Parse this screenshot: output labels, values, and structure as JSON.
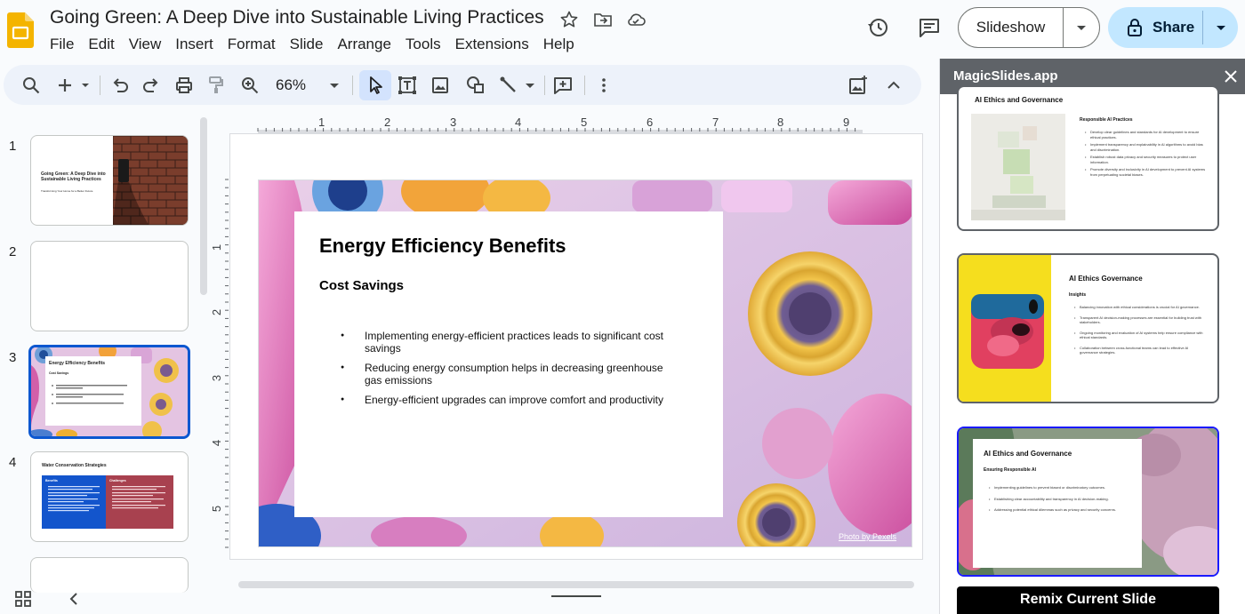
{
  "header": {
    "doc_title": "Going Green: A Deep Dive into Sustainable Living Practices",
    "menu": [
      "File",
      "Edit",
      "View",
      "Insert",
      "Format",
      "Slide",
      "Arrange",
      "Tools",
      "Extensions",
      "Help"
    ],
    "slideshow_label": "Slideshow",
    "share_label": "Share"
  },
  "toolbar": {
    "zoom": "66%"
  },
  "ruler": {
    "top_marks": [
      "1",
      "2",
      "3",
      "4",
      "5",
      "6",
      "7",
      "8",
      "9"
    ],
    "left_marks": [
      "1",
      "2",
      "3",
      "4",
      "5"
    ]
  },
  "filmstrip": {
    "numbers": [
      "1",
      "2",
      "3",
      "4"
    ],
    "thumb1": {
      "title": "Going Green: A Deep Dive into Sustainable Living Practices",
      "subtitle": "Transforming Your Home for a Better Future"
    },
    "thumb3": {
      "title": "Energy Efficiency Benefits",
      "subtitle": "Cost Savings"
    },
    "thumb4": {
      "title": "Water Conservation Strategies",
      "left_head": "Benefits",
      "right_head": "Challenges"
    }
  },
  "slide": {
    "title": "Energy Efficiency Benefits",
    "subtitle": "Cost Savings",
    "bullets": [
      "Implementing energy-efficient practices leads to significant cost savings",
      "Reducing energy consumption helps in decreasing greenhouse gas emissions",
      "Energy-efficient upgrades can improve comfort and productivity"
    ],
    "photo_credit": "Photo by Pexels"
  },
  "panel": {
    "title": "MagicSlides.app",
    "card1": {
      "title": "AI Ethics and Governance",
      "sub": "Responsible AI Practices",
      "bullets": [
        "Develop clear guidelines and standards for AI development to ensure ethical practices.",
        "Implement transparency and explainability in AI algorithms to avoid bias and discrimination.",
        "Establish robust data privacy and security measures to protect user information.",
        "Promote diversity and inclusivity in AI development to prevent AI systems from perpetuating societal biases."
      ]
    },
    "card2": {
      "title": "AI Ethics Governance",
      "sub": "Insights",
      "bullets": [
        "Balancing innovation with ethical considerations is crucial for AI governance.",
        "Transparent AI decision-making processes are essential for building trust with stakeholders.",
        "Ongoing monitoring and evaluation of AI systems help ensure compliance with ethical standards.",
        "Collaboration between cross-functional teams can lead to effective AI governance strategies."
      ]
    },
    "card3": {
      "title": "AI Ethics and Governance",
      "sub": "Ensuring Responsible AI",
      "bullets": [
        "Implementing guidelines to prevent biased or discriminatory outcomes.",
        "Establishing clear accountability and transparency in AI decision-making.",
        "Addressing potential ethical dilemmas such as privacy and security concerns."
      ]
    },
    "remix_label": "Remix Current Slide"
  },
  "colors": {
    "accent_blue": "#0b57d0",
    "share_bg": "#c2e7ff",
    "panel_header": "#5f6368",
    "slides_logo": "#f4b400"
  },
  "icons": [
    "slides-logo-icon",
    "star-icon",
    "move-folder-icon",
    "cloud-status-icon",
    "history-icon",
    "comment-icon",
    "lock-icon",
    "search-icon",
    "add-icon",
    "undo-icon",
    "redo-icon",
    "print-icon",
    "paint-format-icon",
    "zoom-icon",
    "select-icon",
    "textbox-icon",
    "image-icon",
    "shape-icon",
    "line-icon",
    "comment-add-icon",
    "more-vert-icon",
    "background-icon",
    "chevron-up-icon",
    "close-icon",
    "grid-view-icon",
    "chevron-left-icon"
  ]
}
